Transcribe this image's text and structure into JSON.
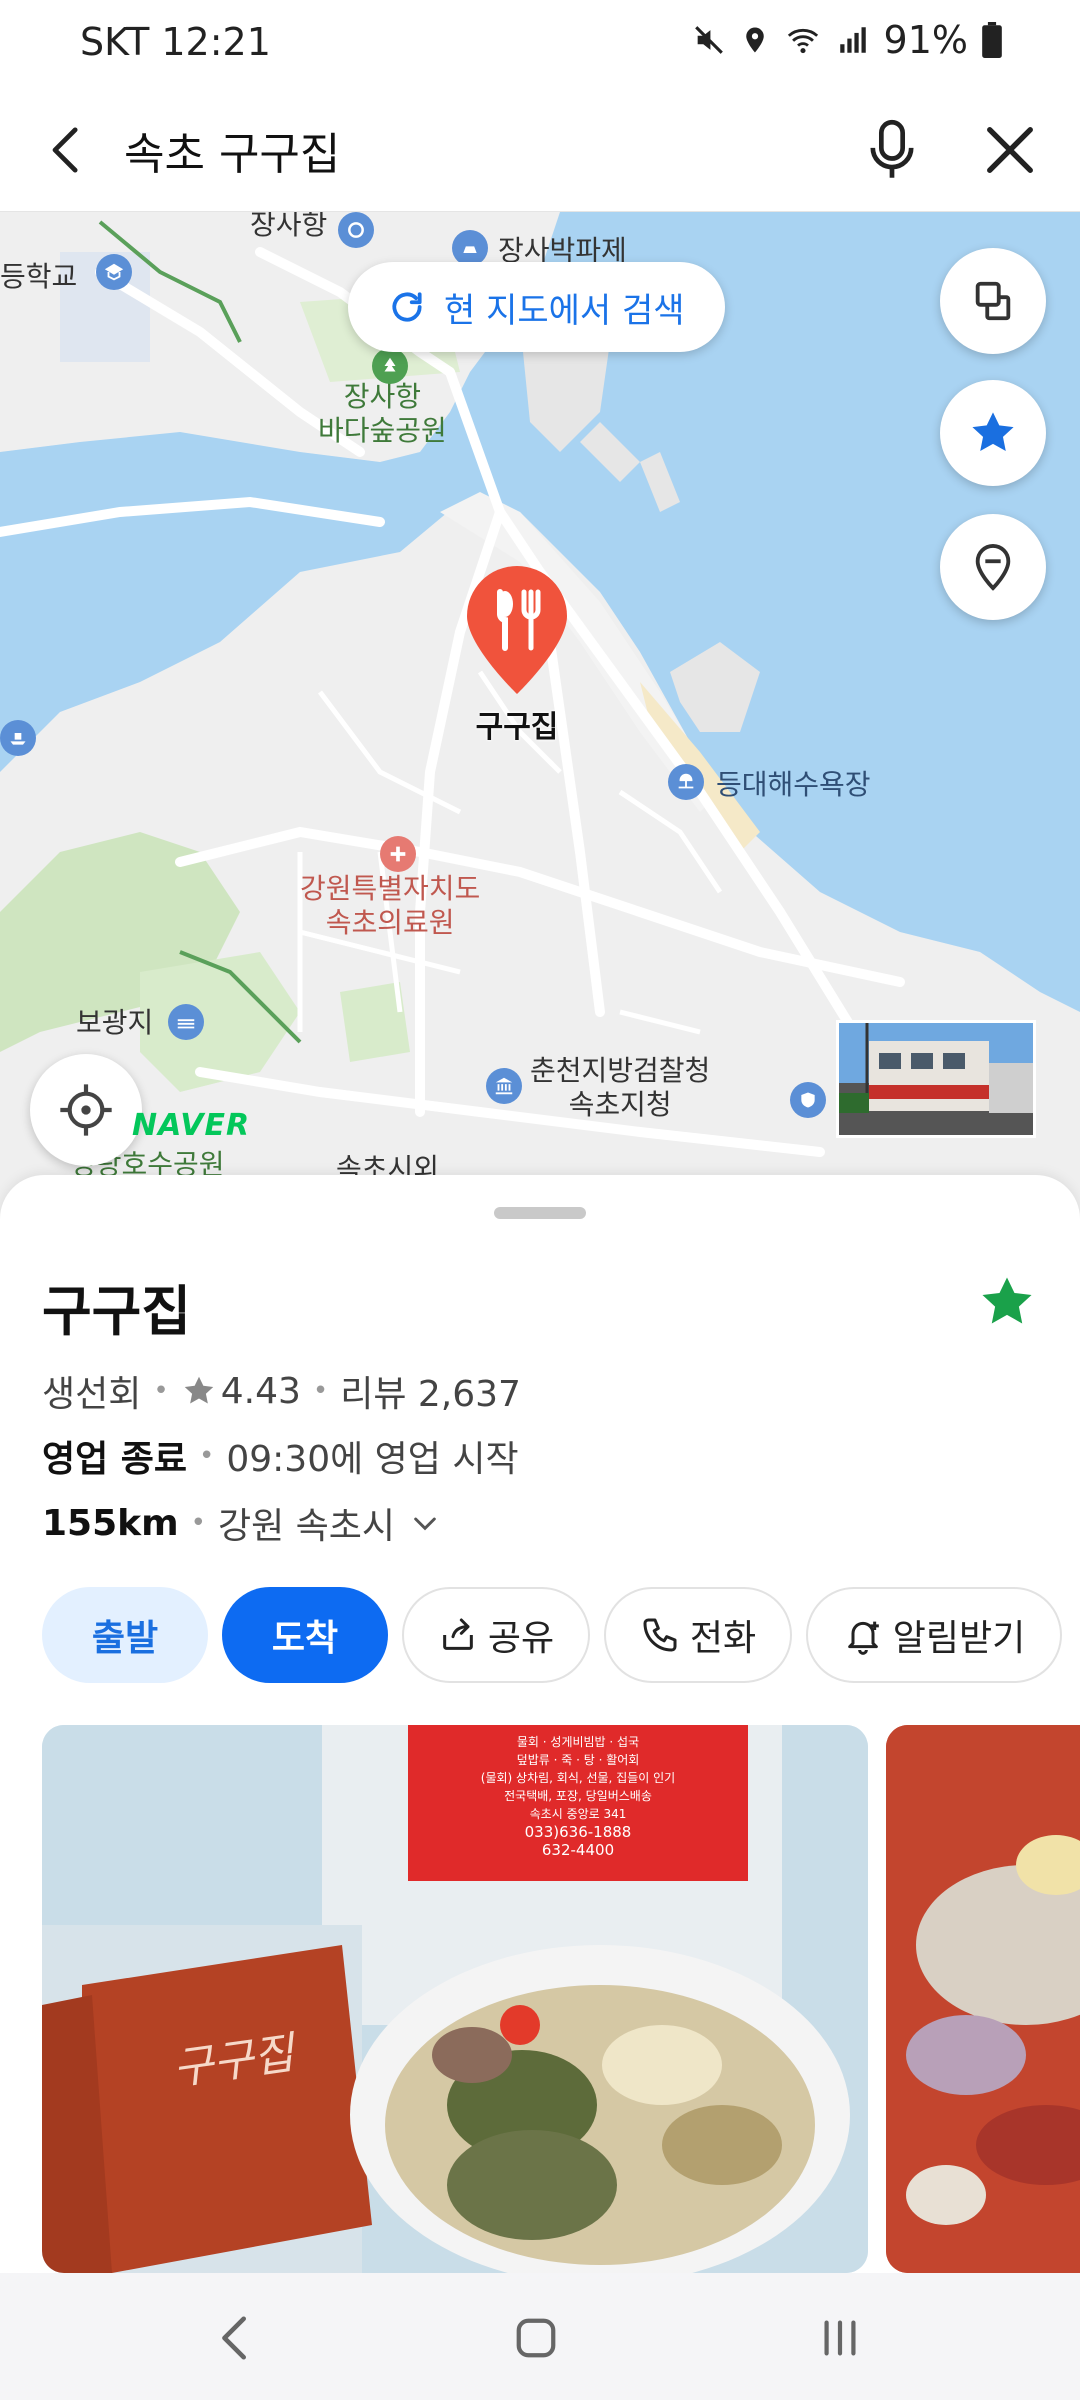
{
  "status_bar": {
    "carrier_time": "SKT 12:21",
    "battery": "91%"
  },
  "search": {
    "query": "속초 구구집"
  },
  "map": {
    "research_button": "현 지도에서 검색",
    "pin_label": "구구집",
    "provider": "NAVER",
    "labels": {
      "jangsahang_top": "장사항",
      "jangsa_pajeon": "장사박파제",
      "school": "등학교",
      "park": "장사항\n바다숲공원",
      "beach": "등대해수욕장",
      "hospital": "강원특별자치도\n속초의료원",
      "bogwangji": "보광지",
      "prosecutor": "춘천지방검찰청\n속초지청",
      "lake_park": "영랑호수공원",
      "city_hall": "속초시외"
    }
  },
  "place": {
    "name": "구구집",
    "category": "생선회",
    "rating": "4.43",
    "reviews": "리뷰 2,637",
    "status": "영업 종료",
    "open_time": "09:30에 영업 시작",
    "distance": "155km",
    "region": "강원 속초시"
  },
  "actions": {
    "depart": "출발",
    "arrive": "도착",
    "share": "공유",
    "call": "전화",
    "alarm": "알림받기"
  },
  "photo_text": {
    "sign_lines": [
      "물회 · 성게비빔밥 · 섭국",
      "덮밥류 · 죽 · 탕 · 활어회",
      "(물회) 상차림, 회식, 선물, 집들이 인기",
      "전국택배, 포장, 당일버스배송",
      "속초시 중앙로 341",
      "033)636-1888",
      "632-4400"
    ],
    "bag_logo": "구구집"
  },
  "colors": {
    "accent_blue": "#0d6bf2",
    "fav_green": "#1aa14a",
    "pin_red": "#f0533c",
    "water": "#a9d3f2"
  }
}
